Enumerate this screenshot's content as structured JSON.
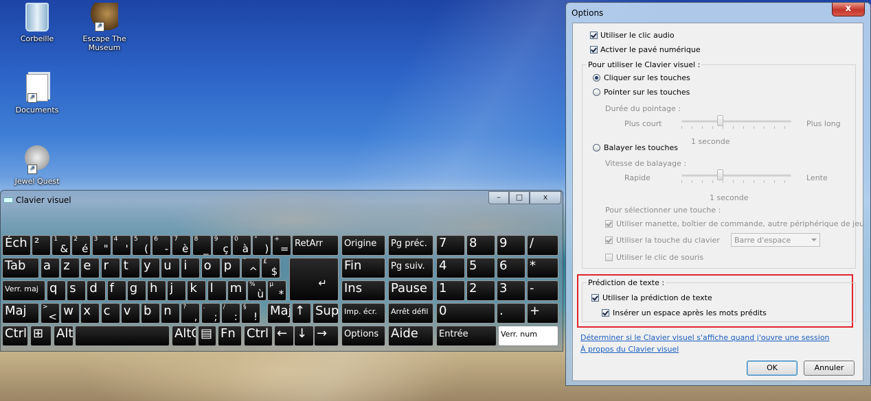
{
  "desktop": {
    "icons": [
      {
        "label": "Corbeille"
      },
      {
        "label": "Escape The Museum"
      },
      {
        "label": "Documents"
      },
      {
        "label": "Jewel Quest"
      }
    ]
  },
  "osk": {
    "title": "Clavier visuel",
    "window_buttons": {
      "minimize": "–",
      "maximize": "□",
      "close": "x"
    },
    "row1": [
      {
        "main": "Éch"
      },
      {
        "main": "²"
      },
      {
        "sub": "1",
        "main": "&"
      },
      {
        "sub": "2",
        "main": "é"
      },
      {
        "sub": "3",
        "main": "\""
      },
      {
        "sub": "4",
        "main": "'"
      },
      {
        "sub": "5",
        "main": "("
      },
      {
        "sub": "6",
        "main": "-"
      },
      {
        "sub": "7",
        "main": "è"
      },
      {
        "sub": "8",
        "main": "_"
      },
      {
        "sub": "9",
        "main": "ç"
      },
      {
        "sub": "0",
        "main": "à"
      },
      {
        "sub": "°",
        "main": ")"
      },
      {
        "sub": "+",
        "main": "="
      },
      {
        "main": "RetArr"
      }
    ],
    "row2": [
      {
        "main": "Tab"
      },
      {
        "main": "a"
      },
      {
        "main": "z"
      },
      {
        "main": "e"
      },
      {
        "main": "r"
      },
      {
        "main": "t"
      },
      {
        "main": "y"
      },
      {
        "main": "u"
      },
      {
        "main": "i"
      },
      {
        "main": "o"
      },
      {
        "main": "p"
      },
      {
        "sub": "¨",
        "main": "^"
      },
      {
        "sub": "£",
        "main": "$"
      }
    ],
    "row3": [
      {
        "main": "Verr. maj"
      },
      {
        "main": "q"
      },
      {
        "main": "s"
      },
      {
        "main": "d"
      },
      {
        "main": "f"
      },
      {
        "main": "g"
      },
      {
        "main": "h"
      },
      {
        "main": "j"
      },
      {
        "main": "k"
      },
      {
        "main": "l"
      },
      {
        "main": "m"
      },
      {
        "sub": "%",
        "main": "ù"
      },
      {
        "sub": "µ",
        "main": "*"
      }
    ],
    "row4": [
      {
        "main": "Maj"
      },
      {
        "sub": ">",
        "main": "<"
      },
      {
        "main": "w"
      },
      {
        "main": "x"
      },
      {
        "main": "c"
      },
      {
        "main": "v"
      },
      {
        "main": "b"
      },
      {
        "main": "n"
      },
      {
        "sub": "?",
        "main": ","
      },
      {
        "sub": ".",
        "main": ";"
      },
      {
        "sub": "/",
        "main": ":"
      },
      {
        "sub": "§",
        "main": "!"
      },
      {
        "main": "Maj"
      },
      {
        "main": "↑"
      },
      {
        "main": "Suppr"
      }
    ],
    "row5": [
      {
        "main": "Ctrl"
      },
      {
        "main": "⊞"
      },
      {
        "main": "Alt"
      },
      {
        "main": ""
      },
      {
        "main": "AltGr"
      },
      {
        "main": "▤"
      },
      {
        "main": "Fn"
      },
      {
        "main": "Ctrl"
      },
      {
        "main": "←"
      },
      {
        "main": "↓"
      },
      {
        "main": "→"
      }
    ],
    "nav": [
      {
        "main": "Origine"
      },
      {
        "main": "Pg préc."
      },
      {
        "main": "Fin"
      },
      {
        "main": "Pg suiv."
      },
      {
        "main": "Ins"
      },
      {
        "main": "Pause"
      },
      {
        "main": "Imp. écr."
      },
      {
        "main": "Arrêt défil"
      },
      {
        "main": "Options"
      },
      {
        "main": "Aide"
      }
    ],
    "numpad": [
      {
        "main": "7"
      },
      {
        "main": "8"
      },
      {
        "main": "9"
      },
      {
        "main": "/"
      },
      {
        "main": "4"
      },
      {
        "main": "5"
      },
      {
        "main": "6"
      },
      {
        "main": "*"
      },
      {
        "main": "1"
      },
      {
        "main": "2"
      },
      {
        "main": "3"
      },
      {
        "main": "-"
      },
      {
        "main": "0"
      },
      {
        "main": "."
      },
      {
        "main": "+"
      },
      {
        "main": "Entrée"
      },
      {
        "main": "Verr. num"
      }
    ]
  },
  "options": {
    "title": "Options",
    "close_label": "x",
    "use_audio_click": "Utiliser le clic audio",
    "enable_numpad": "Activer le pavé numérique",
    "use_group_label": "Pour utiliser le Clavier visuel :",
    "click_keys": "Cliquer sur les touches",
    "hover_keys": "Pointer sur les touches",
    "hover_duration_label": "Durée du pointage :",
    "short_label": "Plus court",
    "long_label": "Plus long",
    "hover_value": "1 seconde",
    "scan_keys": "Balayer les touches",
    "scan_speed_label": "Vitesse de balayage :",
    "fast_label": "Rapide",
    "slow_label": "Lente",
    "scan_value": "1 seconde",
    "select_key_label": "Pour sélectionner une touche :",
    "use_gamepad": "Utiliser manette, boîtier de commande, autre périphérique de jeu",
    "use_keyboard_key": "Utiliser la touche du clavier",
    "keyboard_key_value": "Barre d'espace",
    "use_mouse_click": "Utiliser le clic de souris",
    "prediction_group_label": "Prédiction de texte :",
    "use_prediction": "Utiliser la prédiction de texte",
    "insert_space": "Insérer un espace après les mots prédits",
    "link_logon": "Déterminer si le Clavier visuel s'affiche quand j'ouvre une session",
    "link_about": "À propos du Clavier visuel",
    "ok_label": "OK",
    "cancel_label": "Annuler"
  }
}
